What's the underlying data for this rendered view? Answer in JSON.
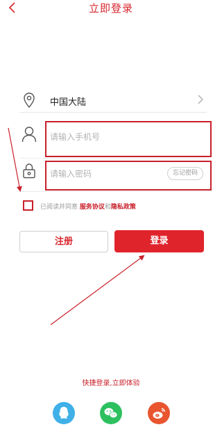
{
  "header": {
    "title": "立即登录",
    "back_icon": "chevron-left-icon"
  },
  "region": {
    "label": "中国大陆",
    "icon": "location-icon"
  },
  "phone": {
    "placeholder": "请输入手机号",
    "value": ""
  },
  "password": {
    "placeholder": "请输入密码",
    "value": "",
    "forgot_label": "忘记密码"
  },
  "agreement": {
    "prefix": "已阅读并同意",
    "terms": "服务协议",
    "and": "和",
    "privacy": "隐私政策",
    "checked": false
  },
  "buttons": {
    "register": "注册",
    "login": "登录"
  },
  "quick_login": {
    "text": "快捷登录,立即体验",
    "providers": [
      "qq-icon",
      "wechat-icon",
      "weibo-icon"
    ]
  },
  "colors": {
    "accent": "#d7262d",
    "qq": "#3fb0e8",
    "wechat": "#2ec05f",
    "weibo": "#e8552f",
    "annotation": "#c8202a"
  }
}
